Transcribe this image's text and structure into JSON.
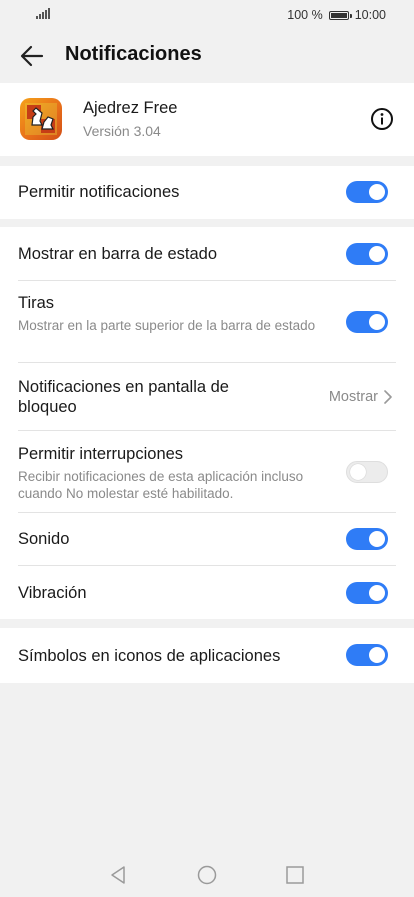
{
  "status_bar": {
    "battery_text": "100 %",
    "time": "10:00",
    "battery_level": 1.0
  },
  "app_bar": {
    "title": "Notificaciones"
  },
  "app_info": {
    "name": "Ajedrez Free",
    "version": "Versión 3.04"
  },
  "settings": {
    "allow": {
      "label": "Permitir notificaciones",
      "enabled": true
    },
    "status_bar": {
      "label": "Mostrar en barra de estado",
      "enabled": true
    },
    "banners": {
      "label": "Tiras",
      "description": "Mostrar en la parte superior de la barra de estado",
      "enabled": true
    },
    "lock_screen": {
      "label": "Notificaciones en pantalla de bloqueo",
      "value": "Mostrar"
    },
    "interruptions": {
      "label": "Permitir interrupciones",
      "description": "Recibir notificaciones de esta aplicación incluso cuando No molestar esté habilitado.",
      "enabled": false
    },
    "sound": {
      "label": "Sonido",
      "enabled": true
    },
    "vibration": {
      "label": "Vibración",
      "enabled": true
    },
    "badges": {
      "label": "Símbolos en iconos de aplicaciones",
      "enabled": true
    }
  },
  "colors": {
    "accent": "#2f7cf6",
    "background": "#f1f1f1",
    "toggle_off": "#ececec"
  }
}
